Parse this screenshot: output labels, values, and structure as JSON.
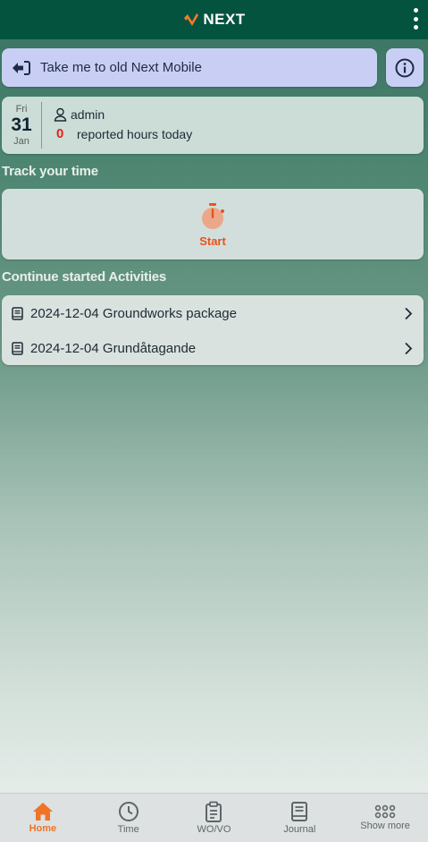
{
  "header": {
    "logo_text": "NEXT"
  },
  "old_mobile": {
    "label": "Take me to old Next Mobile"
  },
  "today": {
    "day_name": "Fri",
    "day_num": "31",
    "month": "Jan",
    "user": "admin",
    "hours": "0",
    "hours_label": "reported hours today"
  },
  "track": {
    "title": "Track your time",
    "start_label": "Start"
  },
  "activities": {
    "title": "Continue started Activities",
    "items": [
      {
        "label": "2024-12-04 Groundworks package"
      },
      {
        "label": "2024-12-04 Grundåtagande"
      }
    ]
  },
  "nav": {
    "items": [
      {
        "label": "Home",
        "icon": "home-icon",
        "active": true
      },
      {
        "label": "Time",
        "icon": "clock-icon"
      },
      {
        "label": "WO/VO",
        "icon": "clipboard-icon"
      },
      {
        "label": "Journal",
        "icon": "book-icon"
      },
      {
        "label": "Show more",
        "icon": "grid-icon"
      }
    ]
  },
  "colors": {
    "topbar": "#04533f",
    "accent": "#ef7426",
    "old_button_bg": "#c9cff4",
    "hours_zero": "#e3241b"
  }
}
